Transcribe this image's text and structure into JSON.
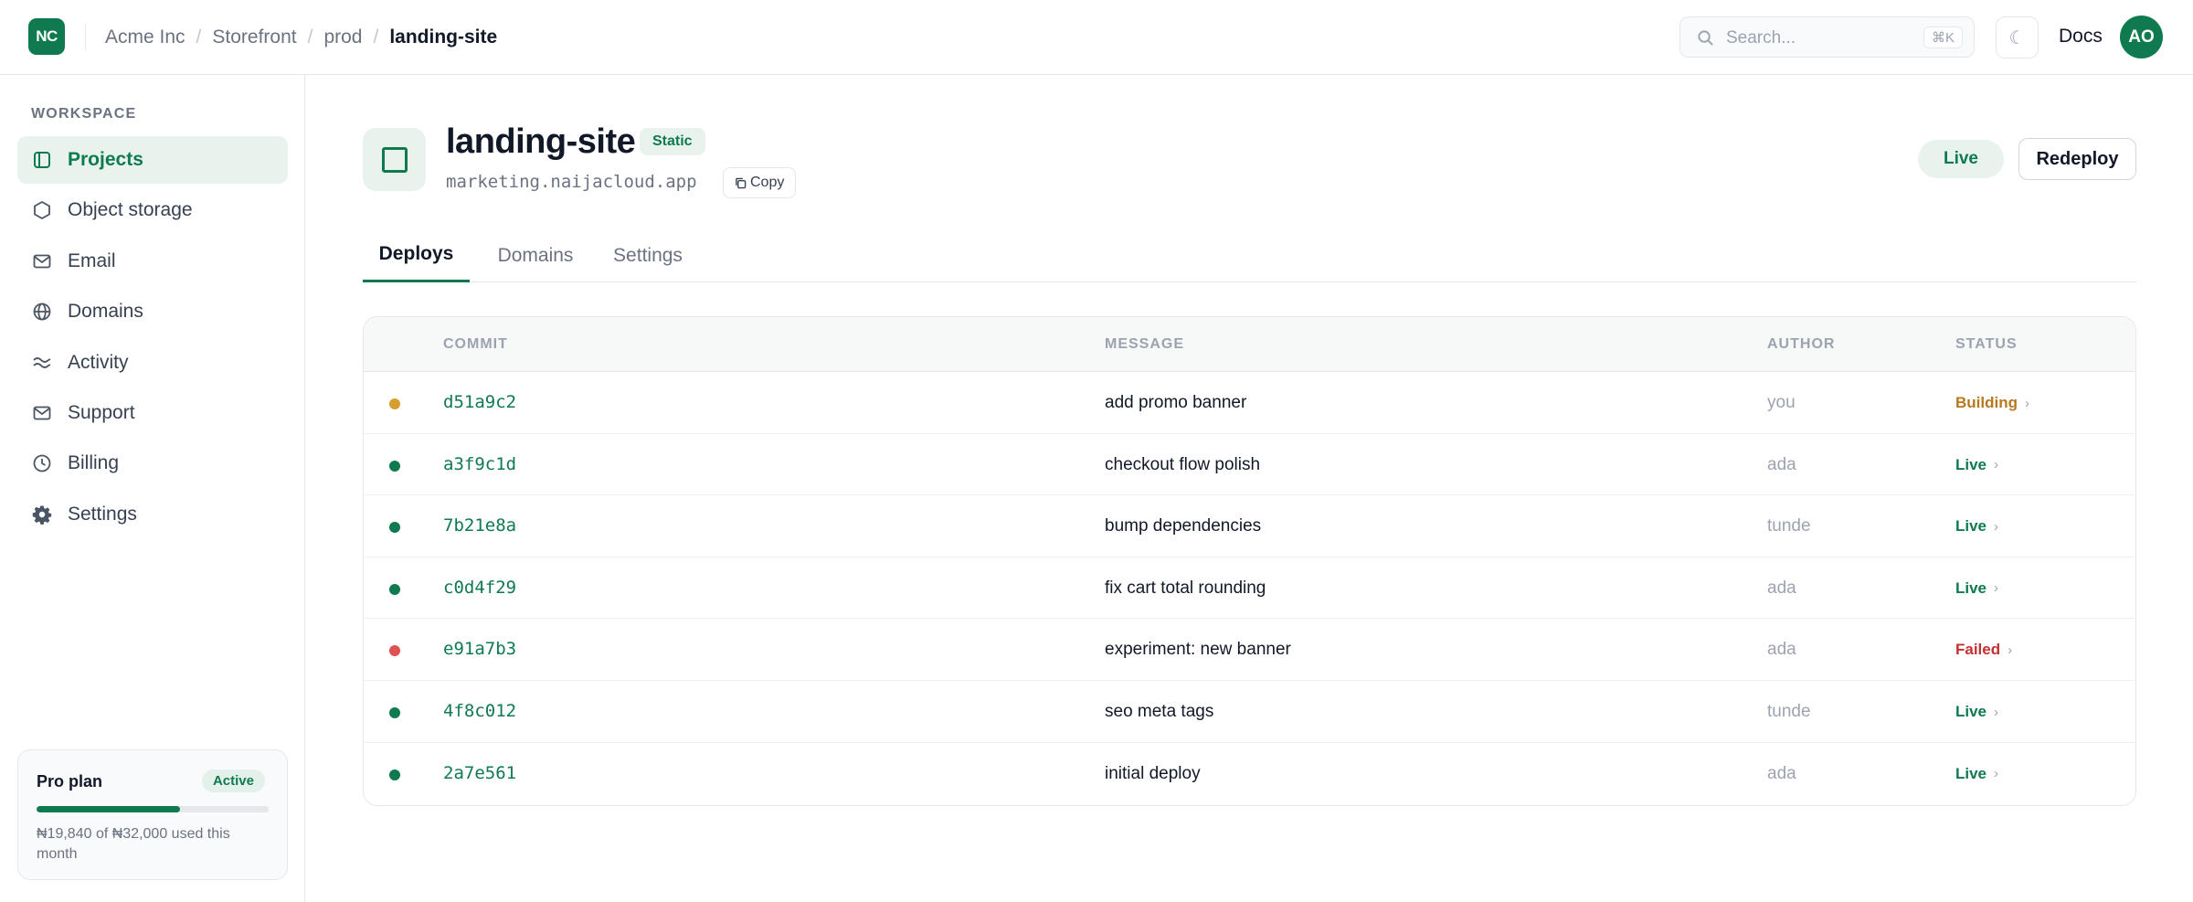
{
  "brand": {
    "logo_text": "NC",
    "accent": "#0f7a4f"
  },
  "breadcrumb": [
    "Acme Inc",
    "Storefront",
    "prod",
    "landing-site"
  ],
  "search": {
    "placeholder": "Search...",
    "shortcut": "⌘K"
  },
  "header": {
    "theme_icon": "moon-icon",
    "docs_label": "Docs",
    "avatar_initials": "AO"
  },
  "sidebar": {
    "section_label": "WORKSPACE",
    "items": [
      {
        "label": "Projects",
        "icon": "projects-icon",
        "active": true
      },
      {
        "label": "Object storage",
        "icon": "storage-icon",
        "active": false
      },
      {
        "label": "Email",
        "icon": "mail-icon",
        "active": false
      },
      {
        "label": "Domains",
        "icon": "globe-icon",
        "active": false
      },
      {
        "label": "Activity",
        "icon": "activity-icon",
        "active": false
      },
      {
        "label": "Support",
        "icon": "support-icon",
        "active": false
      },
      {
        "label": "Billing",
        "icon": "clock-icon",
        "active": false
      },
      {
        "label": "Settings",
        "icon": "gear-icon",
        "active": false
      }
    ],
    "plan": {
      "name": "Pro plan",
      "badge": "Active",
      "usage_text": "₦19,840 of ₦32,000 used this month",
      "used_fraction": 0.62
    }
  },
  "project": {
    "name": "landing-site",
    "type": "Static",
    "url": "marketing.naijacloud.app",
    "copy_label": "Copy",
    "status_pill": "Live",
    "redeploy_label": "Redeploy"
  },
  "tabs": [
    {
      "label": "Deploys",
      "active": true
    },
    {
      "label": "Domains",
      "active": false
    },
    {
      "label": "Settings",
      "active": false
    }
  ],
  "deploys": {
    "columns": [
      "COMMIT",
      "MESSAGE",
      "AUTHOR",
      "STATUS"
    ],
    "status_colors": {
      "Building": "#b7791f",
      "Live": "#0f7a4f",
      "Failed": "#c53030"
    },
    "dot_colors": {
      "Building": "#d69e2e",
      "Live": "#0f7a4f",
      "Failed": "#e05252"
    },
    "rows": [
      {
        "commit": "d51a9c2",
        "message": "add promo banner",
        "author": "you",
        "status": "Building"
      },
      {
        "commit": "a3f9c1d",
        "message": "checkout flow polish",
        "author": "ada",
        "status": "Live"
      },
      {
        "commit": "7b21e8a",
        "message": "bump dependencies",
        "author": "tunde",
        "status": "Live"
      },
      {
        "commit": "c0d4f29",
        "message": "fix cart total rounding",
        "author": "ada",
        "status": "Live"
      },
      {
        "commit": "e91a7b3",
        "message": "experiment: new banner",
        "author": "ada",
        "status": "Failed"
      },
      {
        "commit": "4f8c012",
        "message": "seo meta tags",
        "author": "tunde",
        "status": "Live"
      },
      {
        "commit": "2a7e561",
        "message": "initial deploy",
        "author": "ada",
        "status": "Live"
      }
    ]
  }
}
